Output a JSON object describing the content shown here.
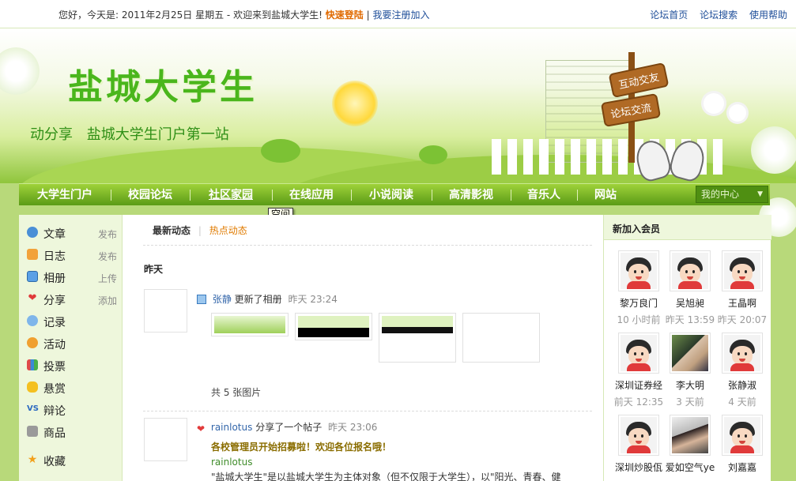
{
  "topbar": {
    "greeting": "您好，今天是: 2011年2月25日 星期五 - 欢迎来到盐城大学生!",
    "quick_login": "快速登陆",
    "sep": "|",
    "register": "我要注册加入",
    "links": [
      "论坛首页",
      "论坛搜索",
      "使用帮助"
    ]
  },
  "banner": {
    "title": "盐城大学生",
    "slogan_left": "动分享",
    "slogan_right": "盐城大学生门户第一站",
    "sign_top": "互动交友",
    "sign_bottom": "论坛交流"
  },
  "nav": {
    "items": [
      "大学生门户",
      "校园论坛",
      "社区家园",
      "在线应用",
      "小说阅读",
      "高清影视",
      "音乐人",
      "网站"
    ],
    "active_index": 2,
    "my_center": "我的中心",
    "tooltip": "空间"
  },
  "left_menu": [
    {
      "label": "文章",
      "action": "发布",
      "icon": "article-icon"
    },
    {
      "label": "日志",
      "action": "发布",
      "icon": "blog-icon"
    },
    {
      "label": "相册",
      "action": "上传",
      "icon": "album-icon"
    },
    {
      "label": "分享",
      "action": "添加",
      "icon": "share-icon"
    },
    {
      "label": "记录",
      "action": "",
      "icon": "record-icon"
    },
    {
      "label": "活动",
      "action": "",
      "icon": "event-icon"
    },
    {
      "label": "投票",
      "action": "",
      "icon": "poll-icon"
    },
    {
      "label": "悬赏",
      "action": "",
      "icon": "reward-icon"
    },
    {
      "label": "辩论",
      "action": "",
      "icon": "debate-icon"
    },
    {
      "label": "商品",
      "action": "",
      "icon": "goods-icon"
    },
    {
      "label": "收藏",
      "action": "",
      "icon": "favorite-icon"
    }
  ],
  "feed": {
    "tabs": [
      "最新动态",
      "热点动态"
    ],
    "tab_sep": "|",
    "day_label": "昨天",
    "items": [
      {
        "user": "张静",
        "action": "更新了相册",
        "time": "昨天 23:24",
        "photo_count": "共 5 张图片"
      },
      {
        "user": "rainlotus",
        "action": "分享了一个帖子",
        "time": "昨天 23:06",
        "post_title": "各校管理员开始招募啦！欢迎各位报名哦！",
        "post_author": "rainlotus",
        "post_excerpt": "\"盐城大学生\"是以盐城大学生为主体对象（但不仅限于大学生），以\"阳光、青春、健"
      }
    ]
  },
  "new_members": {
    "title": "新加入会员",
    "members": [
      {
        "name": "黎万良门",
        "when": "10 小时前"
      },
      {
        "name": "吴旭昶",
        "when": "昨天 13:59"
      },
      {
        "name": "王晶啊",
        "when": "昨天 20:07"
      },
      {
        "name": "深圳证券经",
        "when": "前天 12:35"
      },
      {
        "name": "李大明",
        "when": "3 天前"
      },
      {
        "name": "张静淑",
        "when": "4 天前"
      },
      {
        "name": "深圳炒股佤",
        "when": ""
      },
      {
        "name": "爱如空气ye",
        "when": ""
      },
      {
        "name": "刘嘉嘉",
        "when": ""
      }
    ]
  },
  "colors": {
    "nav_green": "#5a9b16",
    "title_green": "#4ab61c",
    "login_orange": "#e06a00",
    "link_blue": "#1e4e99"
  }
}
